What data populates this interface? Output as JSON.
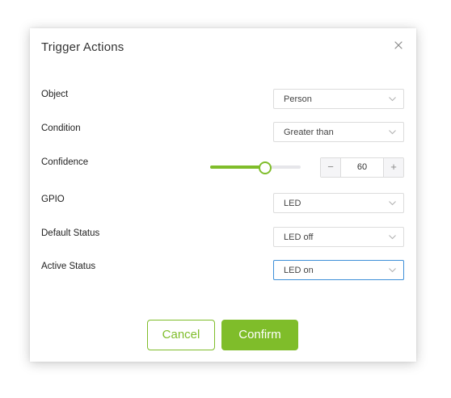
{
  "dialog": {
    "title": "Trigger Actions",
    "close_icon": "close-icon"
  },
  "fields": {
    "object": {
      "label": "Object",
      "value": "Person"
    },
    "condition": {
      "label": "Condition",
      "value": "Greater than"
    },
    "confidence": {
      "label": "Confidence",
      "value": "60",
      "slider_fraction": 0.6,
      "minus": "−",
      "plus": "+"
    },
    "gpio": {
      "label": "GPIO",
      "value": "LED"
    },
    "default_status": {
      "label": "Default Status",
      "value": "LED off"
    },
    "active_status": {
      "label": "Active Status",
      "value": "LED on"
    }
  },
  "buttons": {
    "cancel": "Cancel",
    "confirm": "Confirm"
  },
  "colors": {
    "accent": "#7fbd2a",
    "focus_border": "#3e8fd8"
  }
}
